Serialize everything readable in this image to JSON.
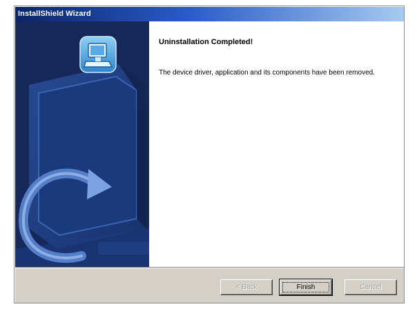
{
  "window": {
    "title": "InstallShield Wizard"
  },
  "content": {
    "heading": "Uninstallation Completed!",
    "message": "The device driver, application and its components have been removed."
  },
  "buttons": {
    "back": "< Back",
    "finish": "Finish",
    "cancel": "Cancel"
  },
  "side_panel": {
    "icon": "computer-installer-icon",
    "artwork": "computer-with-circular-arrow"
  },
  "colors": {
    "title_bar": "#0a246a",
    "side_panel": "#16285a",
    "dialog_face": "#d4d0c8"
  }
}
